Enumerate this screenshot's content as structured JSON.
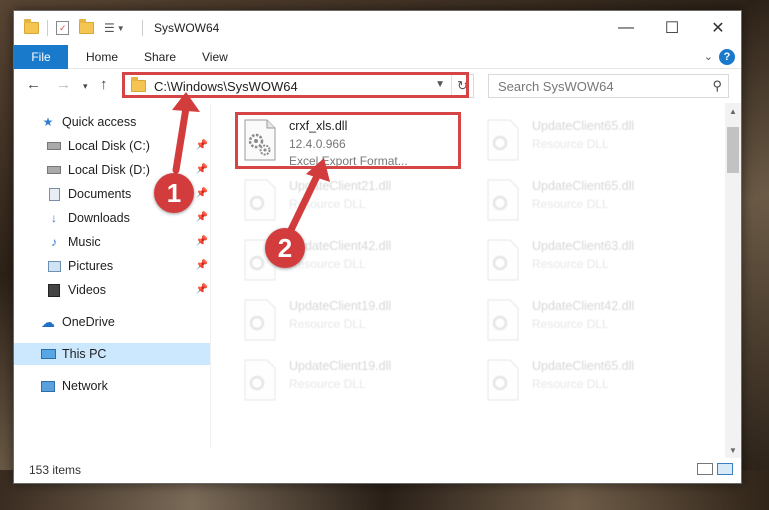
{
  "window": {
    "title": "SysWOW64",
    "minimize": "—",
    "maximize": "☐",
    "close": "✕"
  },
  "ribbon": {
    "tabs": [
      {
        "label": "File"
      },
      {
        "label": "Home"
      },
      {
        "label": "Share"
      },
      {
        "label": "View"
      }
    ],
    "help": "?"
  },
  "address_bar": {
    "path": "C:\\Windows\\SysWOW64",
    "search_placeholder": "Search SysWOW64"
  },
  "sidebar": {
    "items": [
      {
        "label": "Quick access",
        "icon": "star-icon"
      },
      {
        "label": "Local Disk (C:)",
        "icon": "drive-icon",
        "pinned": true
      },
      {
        "label": "Local Disk (D:)",
        "icon": "drive-icon",
        "pinned": true
      },
      {
        "label": "Documents",
        "icon": "documents-icon",
        "pinned": true
      },
      {
        "label": "Downloads",
        "icon": "downloads-icon",
        "pinned": true
      },
      {
        "label": "Music",
        "icon": "music-icon",
        "pinned": true
      },
      {
        "label": "Pictures",
        "icon": "pictures-icon",
        "pinned": true
      },
      {
        "label": "Videos",
        "icon": "videos-icon",
        "pinned": true
      },
      {
        "label": "OneDrive",
        "icon": "cloud-icon"
      },
      {
        "label": "This PC",
        "icon": "pc-icon",
        "selected": true
      },
      {
        "label": "Network",
        "icon": "network-icon"
      }
    ]
  },
  "files": [
    {
      "name": "crxf_xls.dll",
      "version": "12.4.0.966",
      "desc": "Excel Export Format...",
      "highlighted": true
    },
    {
      "name": "UpdateClient65.dll",
      "desc": "Resource DLL"
    },
    {
      "name": "UpdateClient21.dll",
      "desc": "Resource DLL"
    },
    {
      "name": "UpdateClient65.dll",
      "desc": "Resource DLL"
    },
    {
      "name": "UpdateClient42.dll",
      "desc": "Resource DLL"
    },
    {
      "name": "UpdateClient63.dll",
      "desc": "Resource DLL"
    },
    {
      "name": "UpdateClient19.dll",
      "desc": "Resource DLL"
    },
    {
      "name": "UpdateClient42.dll",
      "desc": "Resource DLL"
    },
    {
      "name": "UpdateClient19.dll",
      "desc": "Resource DLL"
    },
    {
      "name": "UpdateClient65.dll",
      "desc": "Resource DLL"
    }
  ],
  "status": {
    "item_count": "153 items"
  },
  "callouts": [
    {
      "label": "1"
    },
    {
      "label": "2"
    }
  ],
  "colors": {
    "accent": "#1979ca",
    "highlight": "#d64545",
    "selected_bg": "#cce8ff"
  }
}
